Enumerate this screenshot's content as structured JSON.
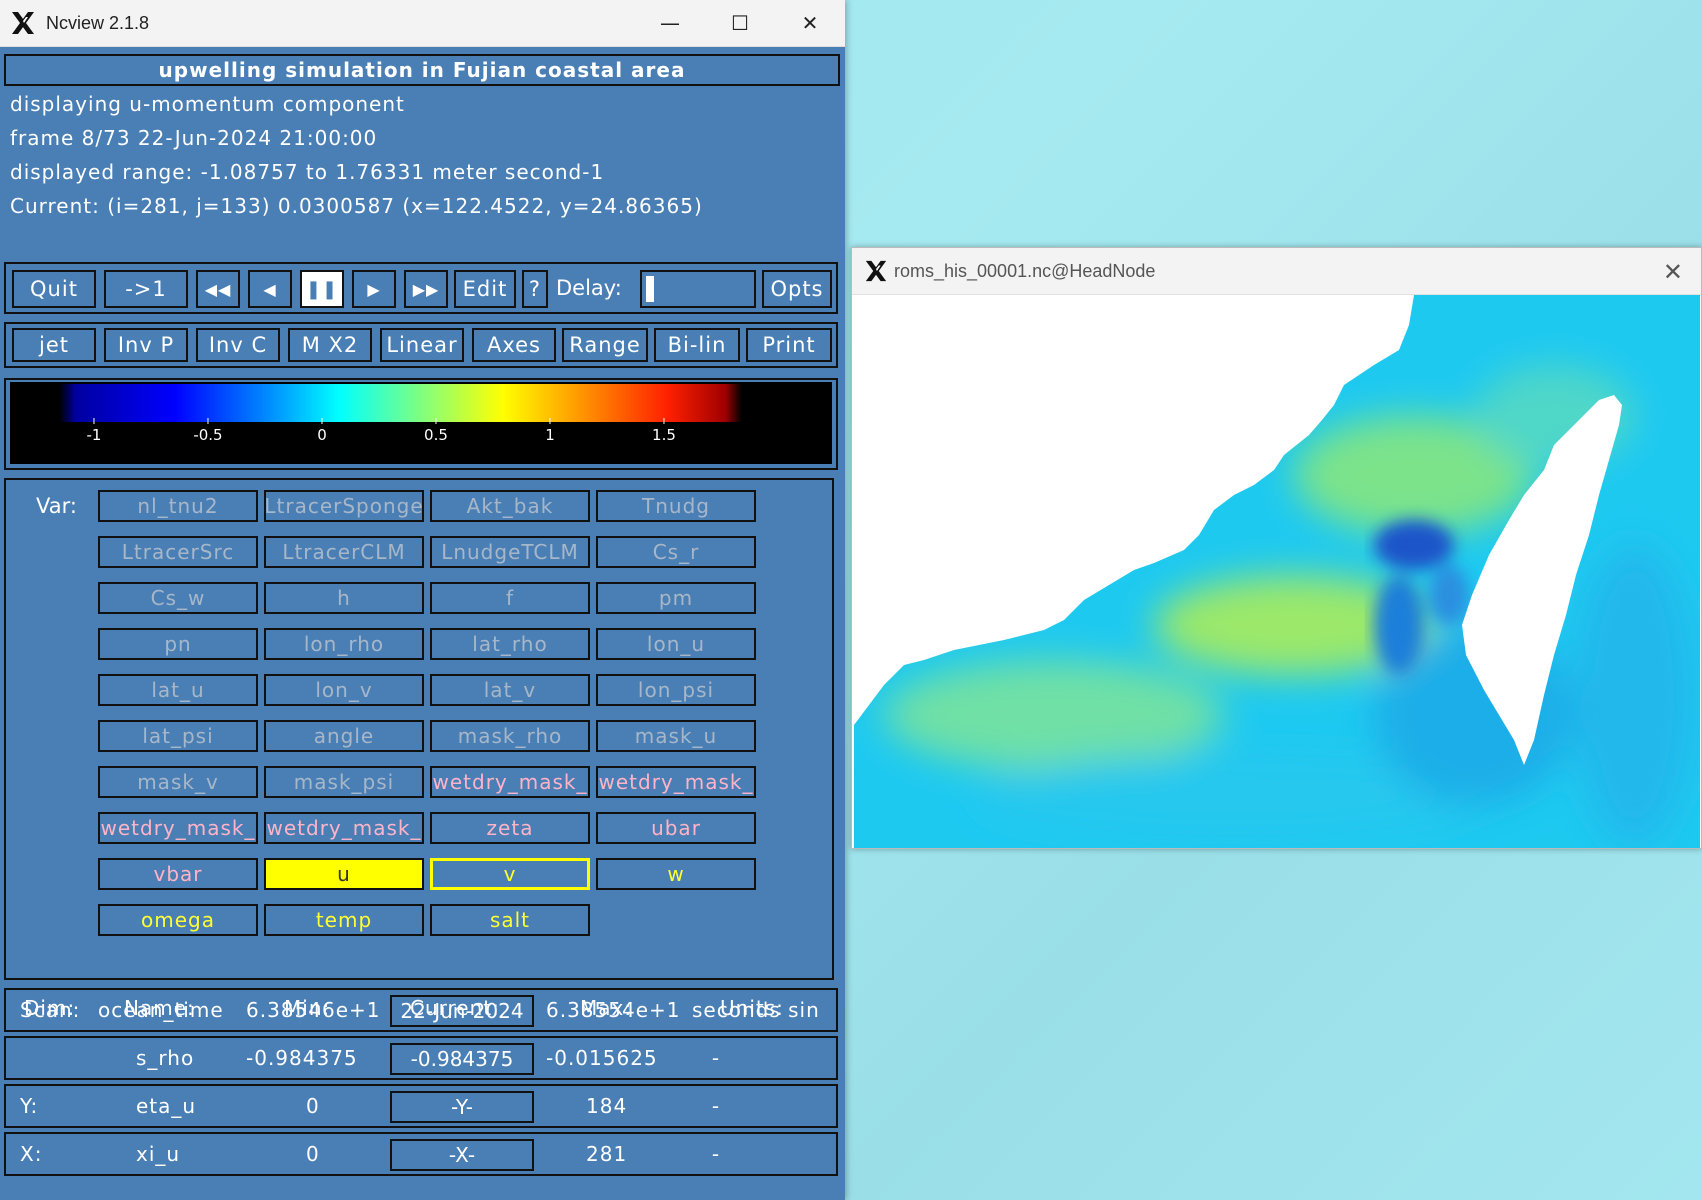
{
  "main_window": {
    "title": "Ncview 2.1.8",
    "controls": {
      "minimize": "—",
      "maximize": "☐",
      "close": "✕"
    },
    "header_title": "upwelling simulation in Fujian coastal area",
    "info": {
      "displaying": "displaying u-momentum component",
      "frame": "frame 8/73 22-Jun-2024 21:00:00",
      "range": "displayed range: -1.08757 to 1.76331 meter second-1",
      "current": "Current: (i=281, j=133) 0.0300587 (x=122.4522, y=24.86365)"
    },
    "toolbar1": {
      "quit": "Quit",
      "goto": "->1",
      "rewind": "◀◀",
      "back": "◀",
      "pause": "❚❚",
      "forward": "▶",
      "fastforward": "▶▶",
      "edit": "Edit",
      "help": "?",
      "delay_label": "Delay:",
      "opts": "Opts"
    },
    "toolbar2": [
      "jet",
      "Inv P",
      "Inv C",
      "M X2",
      "Linear",
      "Axes",
      "Range",
      "Bi-lin",
      "Print"
    ],
    "colorbar": {
      "ticks": [
        "-1",
        "-0.5",
        "0",
        "0.5",
        "1",
        "1.5"
      ],
      "tick_values": [
        -1,
        -0.5,
        0,
        0.5,
        1,
        1.5
      ],
      "range": [
        -1.08757,
        1.76331
      ],
      "colormap": "jet"
    },
    "var_label": "Var:",
    "variables": [
      {
        "name": "nl_tnu2",
        "style": "gray"
      },
      {
        "name": "LtracerSponge",
        "style": "gray"
      },
      {
        "name": "Akt_bak",
        "style": "gray"
      },
      {
        "name": "Tnudg",
        "style": "gray"
      },
      {
        "name": "LtracerSrc",
        "style": "gray"
      },
      {
        "name": "LtracerCLM",
        "style": "gray"
      },
      {
        "name": "LnudgeTCLM",
        "style": "gray"
      },
      {
        "name": "Cs_r",
        "style": "gray"
      },
      {
        "name": "Cs_w",
        "style": "gray"
      },
      {
        "name": "h",
        "style": "gray"
      },
      {
        "name": "f",
        "style": "gray"
      },
      {
        "name": "pm",
        "style": "gray"
      },
      {
        "name": "pn",
        "style": "gray"
      },
      {
        "name": "lon_rho",
        "style": "gray"
      },
      {
        "name": "lat_rho",
        "style": "gray"
      },
      {
        "name": "lon_u",
        "style": "gray"
      },
      {
        "name": "lat_u",
        "style": "gray"
      },
      {
        "name": "lon_v",
        "style": "gray"
      },
      {
        "name": "lat_v",
        "style": "gray"
      },
      {
        "name": "lon_psi",
        "style": "gray"
      },
      {
        "name": "lat_psi",
        "style": "gray"
      },
      {
        "name": "angle",
        "style": "gray"
      },
      {
        "name": "mask_rho",
        "style": "gray"
      },
      {
        "name": "mask_u",
        "style": "gray"
      },
      {
        "name": "mask_v",
        "style": "gray"
      },
      {
        "name": "mask_psi",
        "style": "gray"
      },
      {
        "name": "wetdry_mask_",
        "style": "pink"
      },
      {
        "name": "wetdry_mask_",
        "style": "pink"
      },
      {
        "name": "wetdry_mask_",
        "style": "pink"
      },
      {
        "name": "wetdry_mask_",
        "style": "pink"
      },
      {
        "name": "zeta",
        "style": "pink"
      },
      {
        "name": "ubar",
        "style": "pink"
      },
      {
        "name": "vbar",
        "style": "pink"
      },
      {
        "name": "u",
        "style": "selected"
      },
      {
        "name": "v",
        "style": "outlined"
      },
      {
        "name": "w",
        "style": "yellow"
      },
      {
        "name": "omega",
        "style": "yellow"
      },
      {
        "name": "temp",
        "style": "yellow"
      },
      {
        "name": "salt",
        "style": "yellow"
      }
    ],
    "dim_headers": {
      "dim": "Dim:",
      "name": "Name:",
      "min": "Min:",
      "current": "Current:",
      "max": "Max:",
      "units": "Units:"
    },
    "dims": [
      {
        "label": "Scan:",
        "name": "ocean_time",
        "min": "6.38546e+1",
        "current": "22-Jun-2024",
        "max": "6.38554e+1",
        "units": "seconds sin"
      },
      {
        "label": "",
        "name": "s_rho",
        "min": "-0.984375",
        "current": "-0.984375",
        "max": "-0.015625",
        "units": "-"
      },
      {
        "label": "Y:",
        "name": "eta_u",
        "min": "0",
        "current": "-Y-",
        "max": "184",
        "units": "-"
      },
      {
        "label": "X:",
        "name": "xi_u",
        "min": "0",
        "current": "-X-",
        "max": "281",
        "units": "-"
      }
    ]
  },
  "plot_window": {
    "title": "roms_his_00001.nc@HeadNode",
    "close": "✕"
  }
}
